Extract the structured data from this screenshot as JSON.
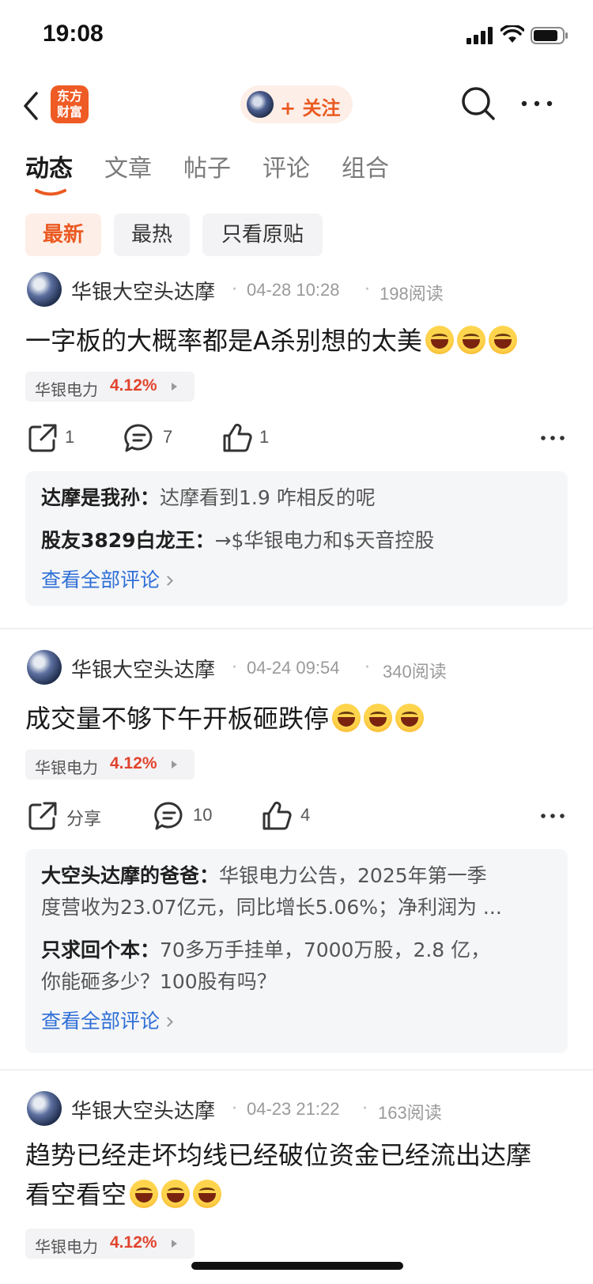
{
  "status_bar": {
    "time": "19:08"
  },
  "header": {
    "logo_text_line1": "东方",
    "logo_text_line2": "财富",
    "follow_label": "+ 关注"
  },
  "tabs": [
    {
      "label": "动态",
      "active": true
    },
    {
      "label": "文章",
      "active": false
    },
    {
      "label": "帖子",
      "active": false
    },
    {
      "label": "评论",
      "active": false
    },
    {
      "label": "组合",
      "active": false
    }
  ],
  "filters": [
    {
      "label": "最新",
      "active": true
    },
    {
      "label": "最热",
      "active": false
    },
    {
      "label": "只看原贴",
      "active": false
    }
  ],
  "posts": [
    {
      "author": "华银大空头达摩",
      "time": "04-28 10:28",
      "reads": "198阅读",
      "text": "一字板的大概率都是A杀别想的太美",
      "stock": {
        "name": "华银电力",
        "change": "4.12%"
      },
      "share_label": "1",
      "comment_count": "7",
      "like_count": "1",
      "comments": [
        {
          "user": "达摩是我孙：",
          "text": "达摩看到1.9 咋相反的呢"
        },
        {
          "user": "股友3829白龙王：",
          "text": "→$华银电力和$天音控股"
        }
      ],
      "view_all": "查看全部评论"
    },
    {
      "author": "华银大空头达摩",
      "time": "04-24 09:54",
      "reads": "340阅读",
      "text": "成交量不够下午开板砸跌停",
      "stock": {
        "name": "华银电力",
        "change": "4.12%"
      },
      "share_label": "分享",
      "comment_count": "10",
      "like_count": "4",
      "comments": [
        {
          "user": "大空头达摩的爸爸：",
          "text": "华银电力公告，2025年第一季",
          "text2": "度营收为23.07亿元，同比增长5.06%；净利润为 ..."
        },
        {
          "user": "只求回个本：",
          "text": "70多万手挂单，7000万股，2.8 亿，",
          "text2": "你能砸多少？100股有吗？"
        }
      ],
      "view_all": "查看全部评论"
    },
    {
      "author": "华银大空头达摩",
      "time": "04-23 21:22",
      "reads": "163阅读",
      "text_line1": "趋势已经走坏均线已经破位资金已经流出达摩",
      "text_line2": "看空看空",
      "stock": {
        "name": "华银电力",
        "change": "4.12%"
      }
    }
  ]
}
